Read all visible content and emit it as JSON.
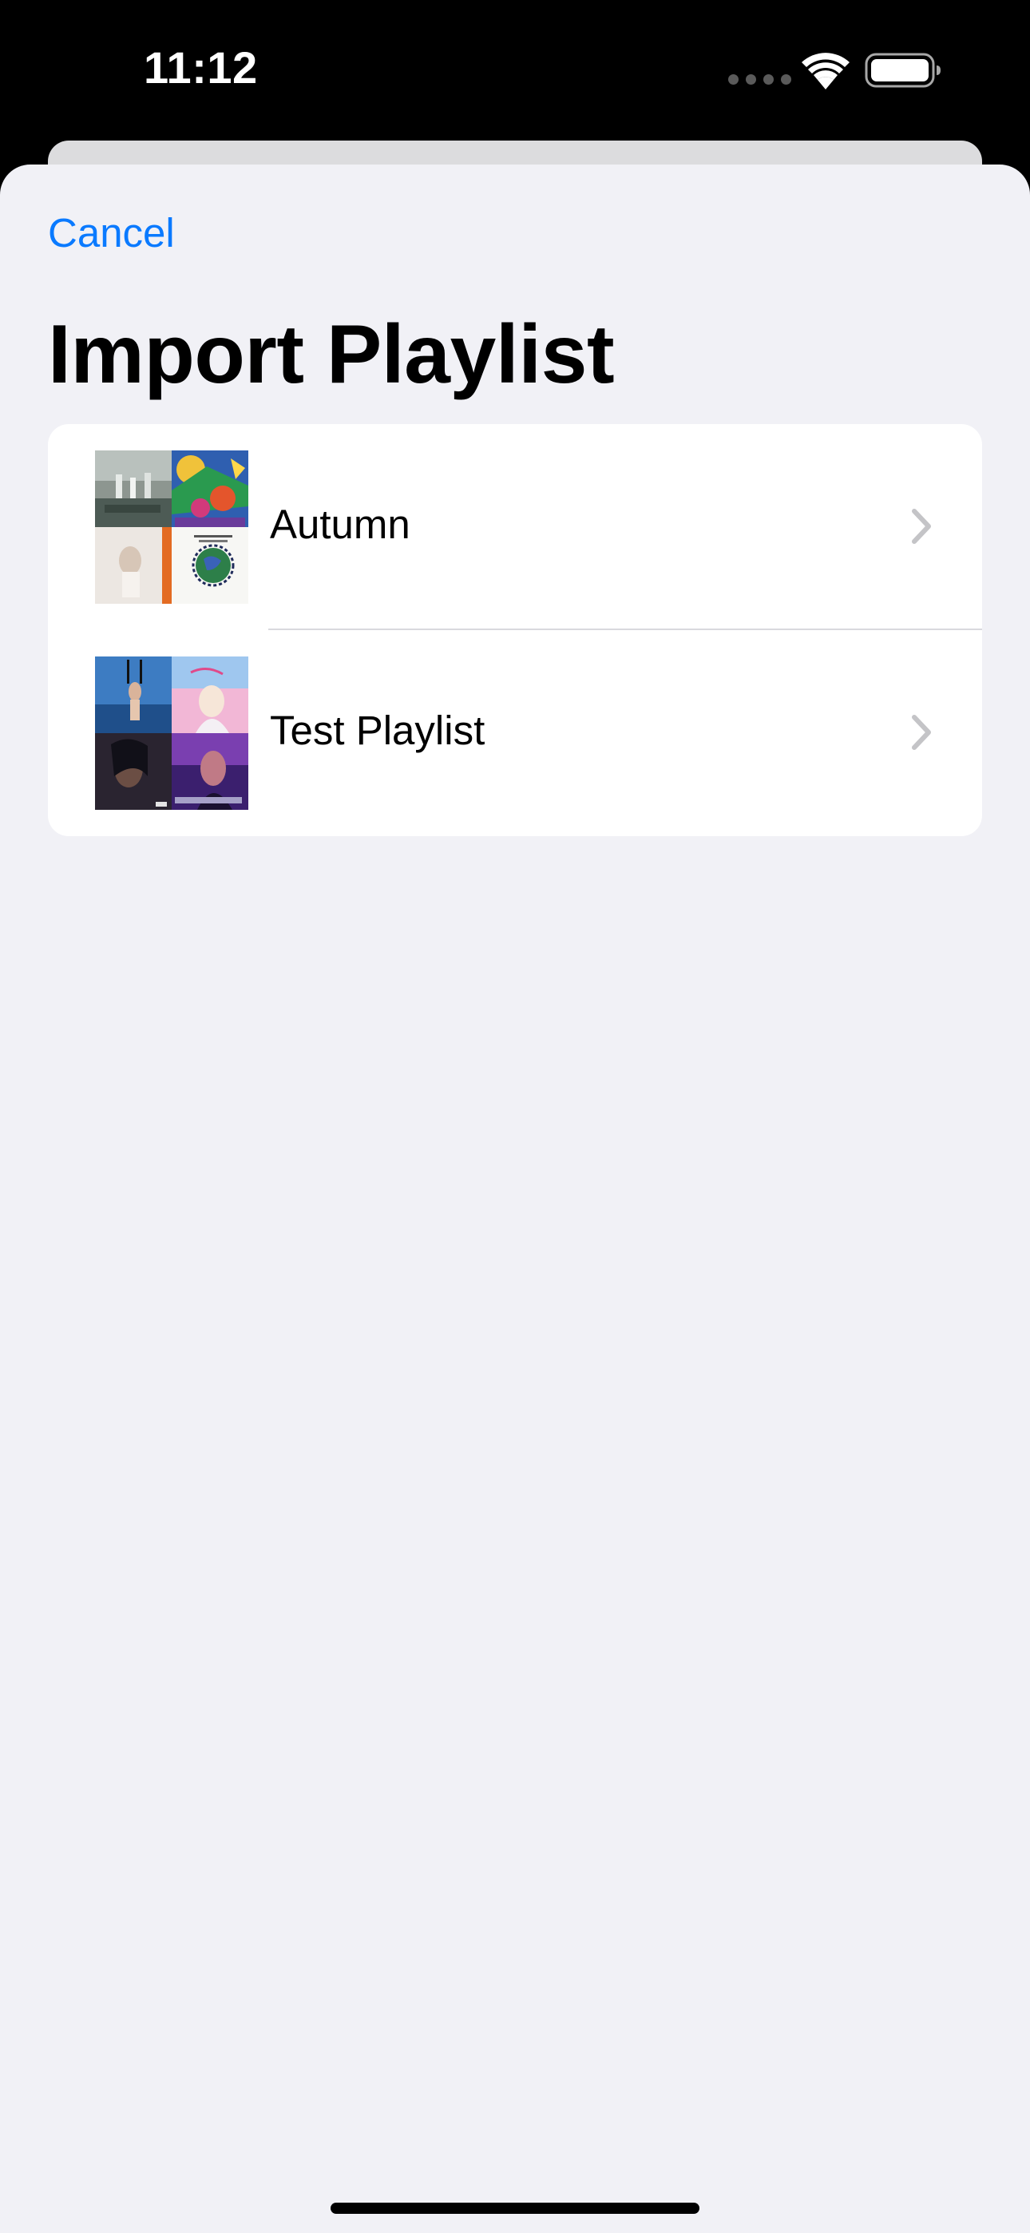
{
  "status_bar": {
    "time": "11:12"
  },
  "nav": {
    "cancel_label": "Cancel"
  },
  "page": {
    "title": "Import Playlist"
  },
  "playlists": [
    {
      "name": "Autumn"
    },
    {
      "name": "Test Playlist"
    }
  ],
  "colors": {
    "accent": "#0a7aff",
    "sheet_background": "#f1f1f6",
    "list_background": "#ffffff",
    "chevron": "#c4c4c7"
  },
  "icons": [
    "signal-dots-icon",
    "wifi-icon",
    "battery-icon",
    "chevron-right-icon"
  ]
}
